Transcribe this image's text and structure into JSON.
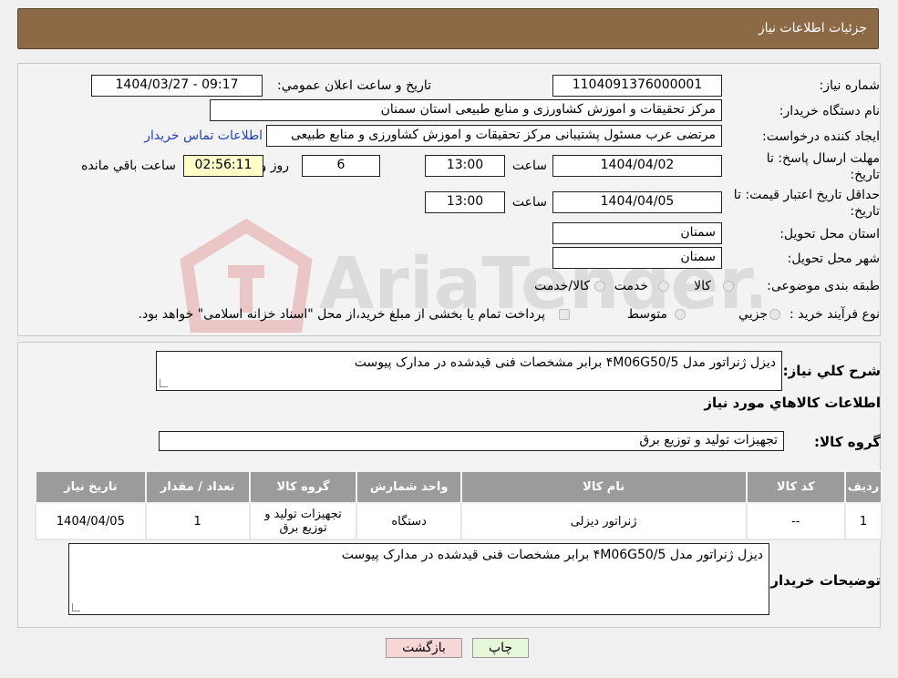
{
  "header": {
    "title": "جزئیات اطلاعات نیاز"
  },
  "form": {
    "need_number_label": "شماره نیاز:",
    "need_number": "1104091376000001",
    "announce_label": "تاریخ و ساعت اعلان عمومي:",
    "announce_value": "1404/03/27 - 09:17",
    "buyer_org_label": "نام دستگاه خريدار:",
    "buyer_org": "مرکز تحقیقات و اموزش کشاورزی و منابع طبیعی استان سمنان",
    "creator_label": "ايجاد کننده درخواست:",
    "creator": "مرتضی عرب مسئول پشتیبانی مرکز تحقیقات و اموزش کشاورزی و منابع طبیعی",
    "contact_link": "اطلاعات تماس خريدار",
    "deadline_label": "مهلت ارسال پاسخ: تا تاريخ:",
    "deadline_date": "1404/04/02",
    "time_label": "ساعت",
    "deadline_time": "13:00",
    "days": "6",
    "days_label": "روز و",
    "remaining": "02:56:11",
    "remaining_label": "ساعت باقي مانده",
    "validity_label": "حداقل تاريخ اعتبار قيمت: تا تاريخ:",
    "validity_date": "1404/04/05",
    "validity_time": "13:00",
    "province_label": "استان محل تحويل:",
    "province": "سمنان",
    "city_label": "شهر محل تحويل:",
    "city": "سمنان",
    "category_label": "طبقه بندی موضوعی:",
    "category_options": [
      "کالا",
      "خدمت",
      "کالا/خدمت"
    ],
    "process_label": "نوع فرآیند خرید :",
    "process_options": [
      "جزيي",
      "متوسط"
    ],
    "process_note": "پرداخت تمام یا بخشی از مبلغ خرید،از محل \"اسناد خزانه اسلامی\" خواهد بود."
  },
  "description": {
    "label": "شرح کلي نياز:",
    "value": "دیزل ژنراتور مدل ۴M06G50/5 برابر مشخصات فنی قیدشده در مدارک پیوست",
    "goods_info_title": "اطلاعات کالاهاي مورد نياز",
    "group_label": "گروه کالا:",
    "group_value": "تجهیزات تولید و توزیع برق"
  },
  "table": {
    "headers": [
      "رديف",
      "کد کالا",
      "نام کالا",
      "واحد شمارش",
      "گروه کالا",
      "تعداد / مقدار",
      "تاريخ نياز"
    ],
    "rows": [
      [
        "1",
        "--",
        "ژنراتور دیزلی",
        "دستگاه",
        "تجهیزات تولید و توزیع برق",
        "1",
        "1404/04/05"
      ]
    ]
  },
  "buyer_notes": {
    "label": "توضيحات خريدار:",
    "value": "دیزل ژنراتور مدل ۴M06G50/5 برابر مشخصات فنی قیدشده در مدارک پیوست"
  },
  "buttons": {
    "print": "چاپ",
    "back": "بازگشت"
  },
  "watermark": {
    "text": "AriaTender.neT"
  },
  "colors": {
    "header": "#8b6a45",
    "back_button": "#f7d6d6",
    "print_button": "#e6f7d9",
    "link": "#2040c0"
  }
}
